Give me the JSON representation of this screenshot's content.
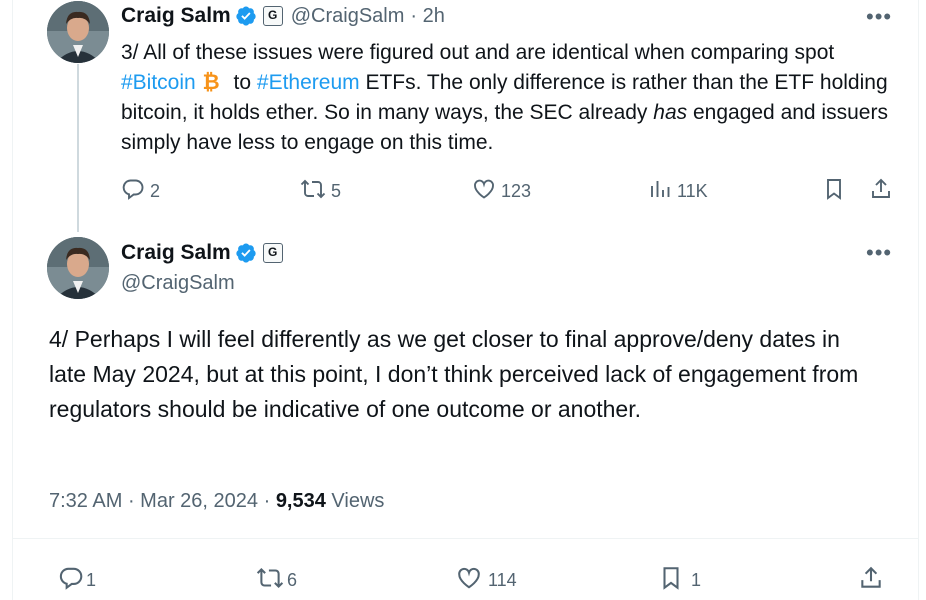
{
  "tweet1": {
    "name": "Craig Salm",
    "handle": "@CraigSalm",
    "time": "· 2h",
    "text": {
      "p1": "3/ All of these issues were figured out and are identical when comparing spot ",
      "tag1": "#Bitcoin",
      "p2": " to ",
      "tag2": "#Ethereum",
      "p3": " ETFs. The only difference is rather than the ETF holding bitcoin, it holds ether. So in many ways, the SEC already ",
      "em": "has",
      "p4": " engaged and issuers simply have less to engage on this time."
    },
    "actions": {
      "replies": "2",
      "reposts": "5",
      "likes": "123",
      "views": "11K"
    }
  },
  "tweet2": {
    "name": "Craig Salm",
    "handle": "@CraigSalm",
    "text": "4/ Perhaps I will feel differently as we get closer to final approve/deny dates in late May 2024, but at this point, I don’t think perceived lack of engagement from regulators should be indicative of one outcome or another.",
    "meta": {
      "time": "7:32 AM",
      "sep1": " · ",
      "date": "Mar 26, 2024",
      "sep2": " · ",
      "views_count": "9,534",
      "views_label": " Views"
    },
    "actions": {
      "replies": "1",
      "reposts": "6",
      "likes": "114",
      "bookmarks": "1"
    }
  },
  "badges": {
    "affiliate_letter": "G"
  },
  "colors": {
    "accent": "#1d9bf0",
    "text": "#0f1419",
    "muted": "#536471",
    "bitcoin": "#f7931a"
  },
  "icons": [
    "verified-badge-icon",
    "affiliate-badge-icon",
    "more-icon",
    "reply-icon",
    "repost-icon",
    "like-icon",
    "views-icon",
    "bookmark-icon",
    "share-icon",
    "bitcoin-icon"
  ]
}
